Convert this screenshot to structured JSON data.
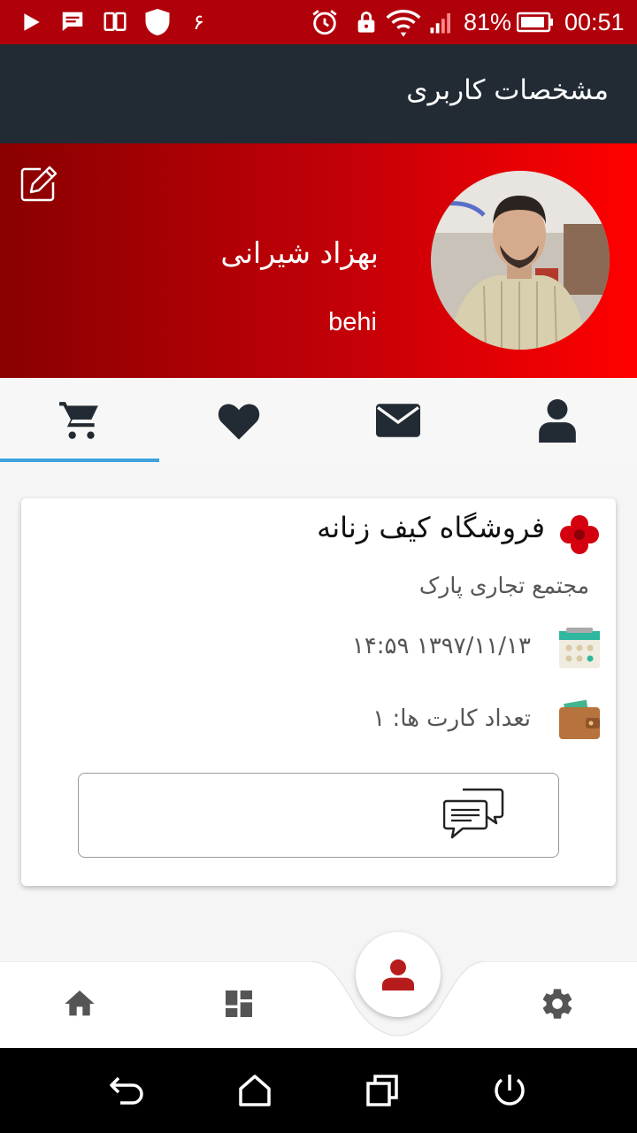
{
  "status_bar": {
    "battery_percent": "81%",
    "time": "00:51",
    "notification_digit": "۶"
  },
  "app_bar": {
    "title": "مشخصات کاربری"
  },
  "profile": {
    "name": "بهزاد شیرانی",
    "username": "behi"
  },
  "tabs": [
    {
      "icon": "cart-icon",
      "active": true
    },
    {
      "icon": "heart-icon",
      "active": false
    },
    {
      "icon": "envelope-icon",
      "active": false
    },
    {
      "icon": "user-icon",
      "active": false
    }
  ],
  "card": {
    "title": "فروشگاه کیف زنانه",
    "subtitle": "مجتمع تجاری پارک",
    "datetime": "۱۳۹۷/۱۱/۱۳ ۱۴:۵۹",
    "card_count": "تعداد کارت ها: ۱"
  },
  "bottom_nav": [
    "home-icon",
    "dashboard-icon",
    "profile-icon",
    "settings-icon"
  ],
  "colors": {
    "status_bar": "#b0000a",
    "app_bar": "#222b33",
    "header_gradient_start": "#8a0000",
    "header_gradient_end": "#ff0000",
    "tab_indicator": "#3da1dc",
    "fab_icon": "#b71c1c"
  }
}
